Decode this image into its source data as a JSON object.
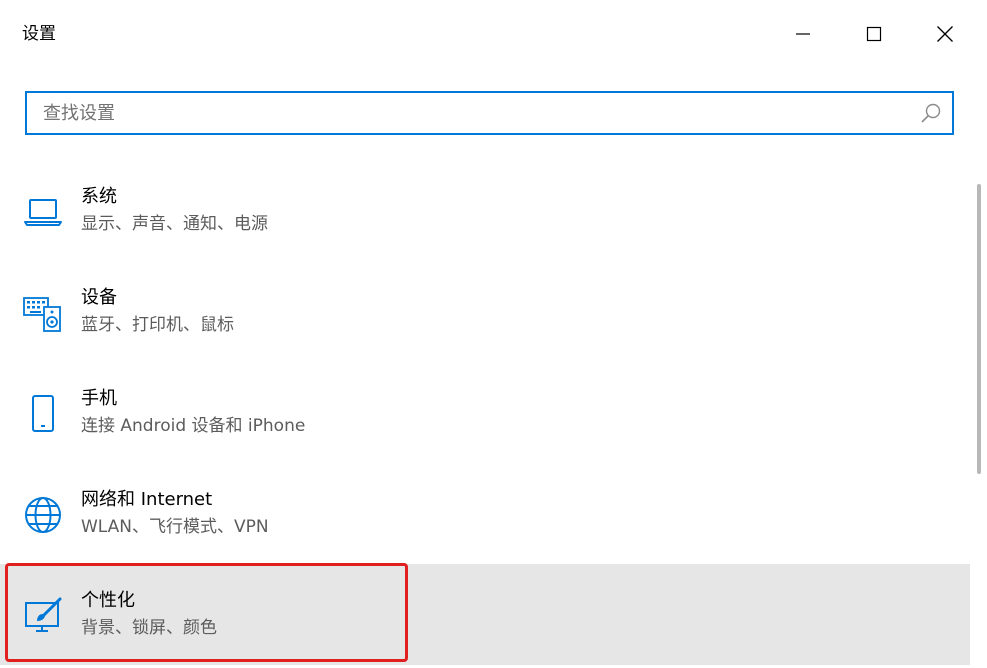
{
  "window": {
    "title": "设置"
  },
  "search": {
    "placeholder": "查找设置",
    "value": ""
  },
  "categories": [
    {
      "title": "系统",
      "description": "显示、声音、通知、电源",
      "icon": "laptop-icon"
    },
    {
      "title": "设备",
      "description": "蓝牙、打印机、鼠标",
      "icon": "devices-icon"
    },
    {
      "title": "手机",
      "description": "连接 Android 设备和 iPhone",
      "icon": "phone-icon"
    },
    {
      "title": "网络和 Internet",
      "description": "WLAN、飞行模式、VPN",
      "icon": "globe-icon"
    },
    {
      "title": "个性化",
      "description": "背景、锁屏、颜色",
      "icon": "personalization-icon",
      "selected": true
    }
  ],
  "colors": {
    "accent": "#0078d7",
    "highlight_border": "#e0201f",
    "selected_background": "#e6e6e6",
    "secondary_text": "#5c5c5c"
  }
}
